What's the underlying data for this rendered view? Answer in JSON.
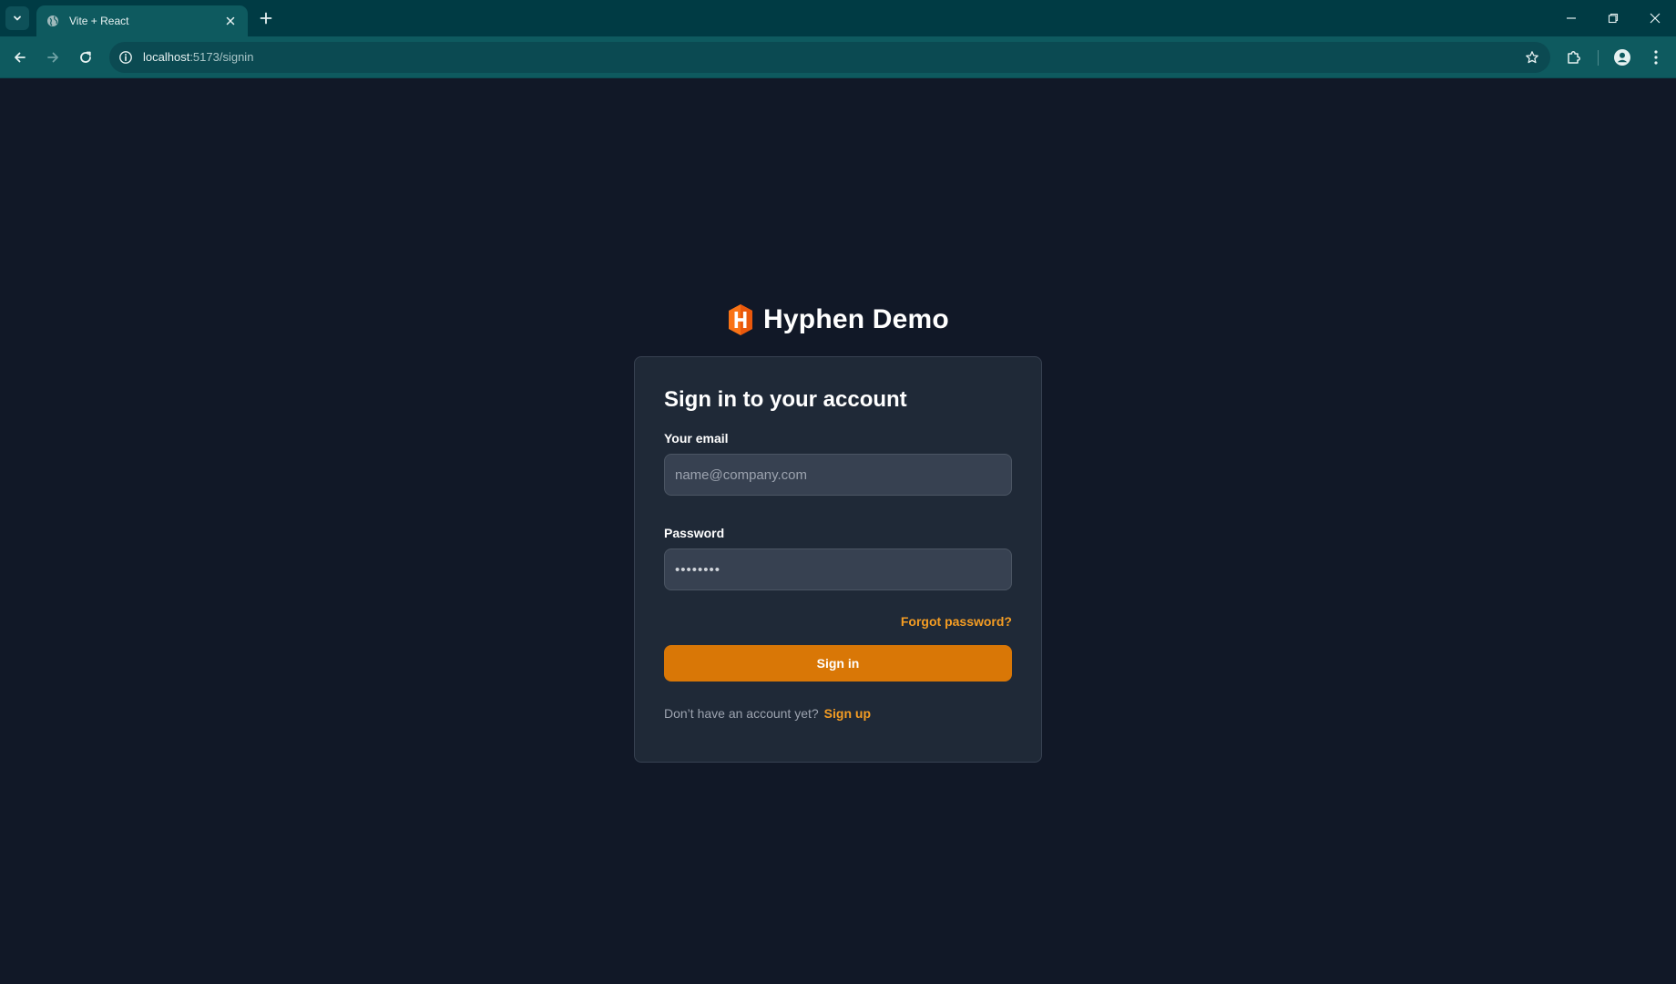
{
  "browser": {
    "tab_title": "Vite + React",
    "url_host": "localhost",
    "url_path": ":5173/signin"
  },
  "brand": {
    "name": "Hyphen Demo",
    "logo_colors": [
      "#f97316",
      "#ea580c",
      "#ffffff"
    ]
  },
  "signin": {
    "title": "Sign in to your account",
    "email_label": "Your email",
    "email_placeholder": "name@company.com",
    "email_value": "",
    "password_label": "Password",
    "password_value": "••••••••",
    "forgot_label": "Forgot password?",
    "submit_label": "Sign in",
    "no_account_text": "Don’t have an account yet?",
    "signup_label": "Sign up"
  },
  "colors": {
    "page_bg": "#111827",
    "card_bg": "#1f2937",
    "accent": "#d97706",
    "link": "#f59d23",
    "chrome_bg": "#003b44",
    "toolbar_bg": "#0e5a5f"
  },
  "icons": {
    "tab_menu": "chevron-down-icon",
    "favicon": "globe-icon",
    "tab_close": "close-icon",
    "new_tab": "plus-icon",
    "back": "arrow-left-icon",
    "forward": "arrow-right-icon",
    "reload": "reload-icon",
    "site_info": "info-icon",
    "bookmark": "star-icon",
    "extensions": "puzzle-icon",
    "profile": "person-icon",
    "menu": "kebab-menu-icon",
    "minimize": "minimize-icon",
    "restore": "restore-icon",
    "close_window": "close-window-icon"
  }
}
